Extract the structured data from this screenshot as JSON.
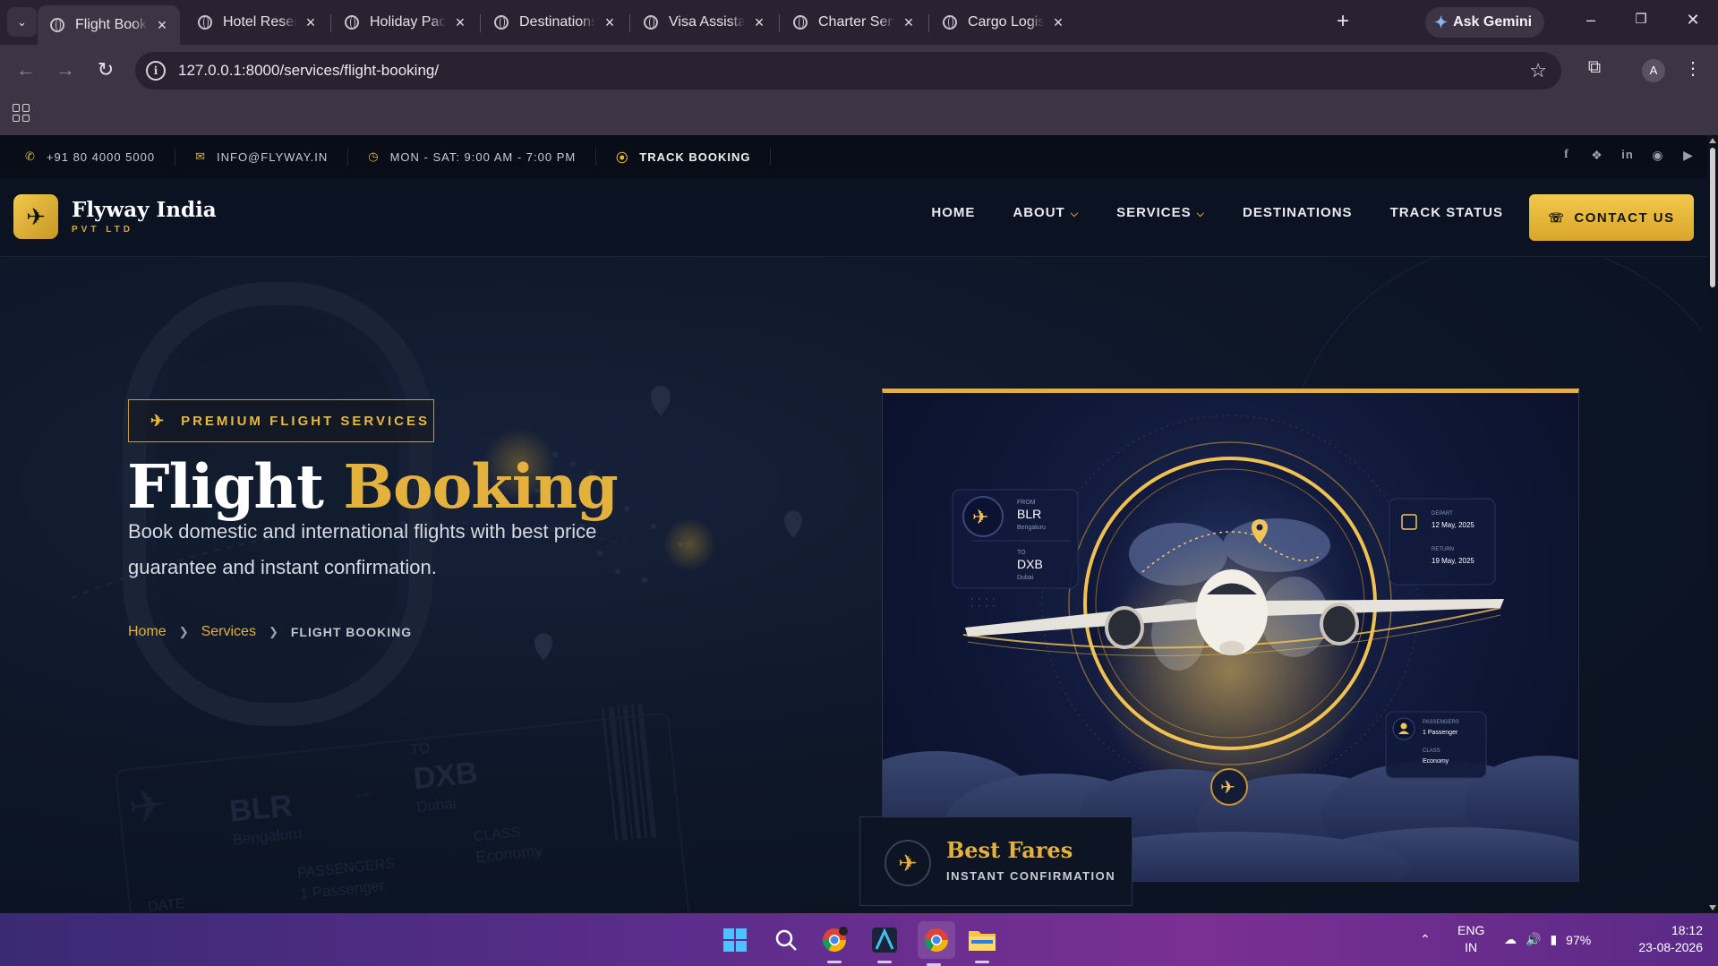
{
  "browser": {
    "tabs": [
      {
        "label": "Flight Booking Se",
        "active": true
      },
      {
        "label": "Hotel Reservation",
        "active": false
      },
      {
        "label": "Holiday Packages",
        "active": false
      },
      {
        "label": "Destinations | Flyw",
        "active": false
      },
      {
        "label": "Visa Assistance Se",
        "active": false
      },
      {
        "label": "Charter Services |",
        "active": false
      },
      {
        "label": "Cargo Logistics Se",
        "active": false
      }
    ],
    "ask_gemini": "Ask Gemini",
    "url": "127.0.0.1:8000/services/flight-booking/",
    "profile_initial": "A"
  },
  "topbar": {
    "phone": "+91 80 4000 5000",
    "email": "INFO@FLYWAY.IN",
    "hours": "MON - SAT: 9:00 AM - 7:00 PM",
    "track": "TRACK BOOKING"
  },
  "nav": {
    "brand": "Flyway India",
    "brand_sub": "PVT LTD",
    "items": [
      "HOME",
      "ABOUT",
      "SERVICES",
      "DESTINATIONS",
      "TRACK STATUS"
    ],
    "contact": "CONTACT US"
  },
  "hero": {
    "badge": "PREMIUM FLIGHT SERVICES",
    "title_1": "Flight",
    "title_2": "Booking",
    "description": "Book domestic and international flights with best price guarantee and instant confirmation.",
    "breadcrumb": {
      "home": "Home",
      "services": "Services",
      "current": "FLIGHT BOOKING"
    }
  },
  "bg_ticket": {
    "from_code": "BLR",
    "from_city": "Bengaluru",
    "to_label": "TO",
    "to_code": "DXB",
    "to_city": "Dubai",
    "passengers_label": "PASSENGERS",
    "passengers": "1 Passenger",
    "class_label": "CLASS",
    "class": "Economy",
    "date_label": "DATE"
  },
  "card": {
    "from_label": "FROM",
    "from_code": "BLR",
    "from_city": "Bengaluru",
    "to_label": "TO",
    "to_code": "DXB",
    "to_city": "Dubai",
    "depart_label": "DEPART",
    "depart": "12 May, 2025",
    "return_label": "RETURN",
    "return": "19 May, 2025",
    "passengers_label": "PASSENGERS",
    "passengers": "1 Passenger",
    "class_label": "CLASS",
    "class": "Economy"
  },
  "fares": {
    "title": "Best Fares",
    "subtitle": "INSTANT CONFIRMATION"
  },
  "system": {
    "lang_1": "ENG",
    "lang_2": "IN",
    "battery": "97%",
    "time": "18:12",
    "date": "23-08-2026"
  },
  "colors": {
    "accent": "#e4b23c",
    "page_bg": "#0c1420",
    "taskbar": "#5c2d8c"
  }
}
